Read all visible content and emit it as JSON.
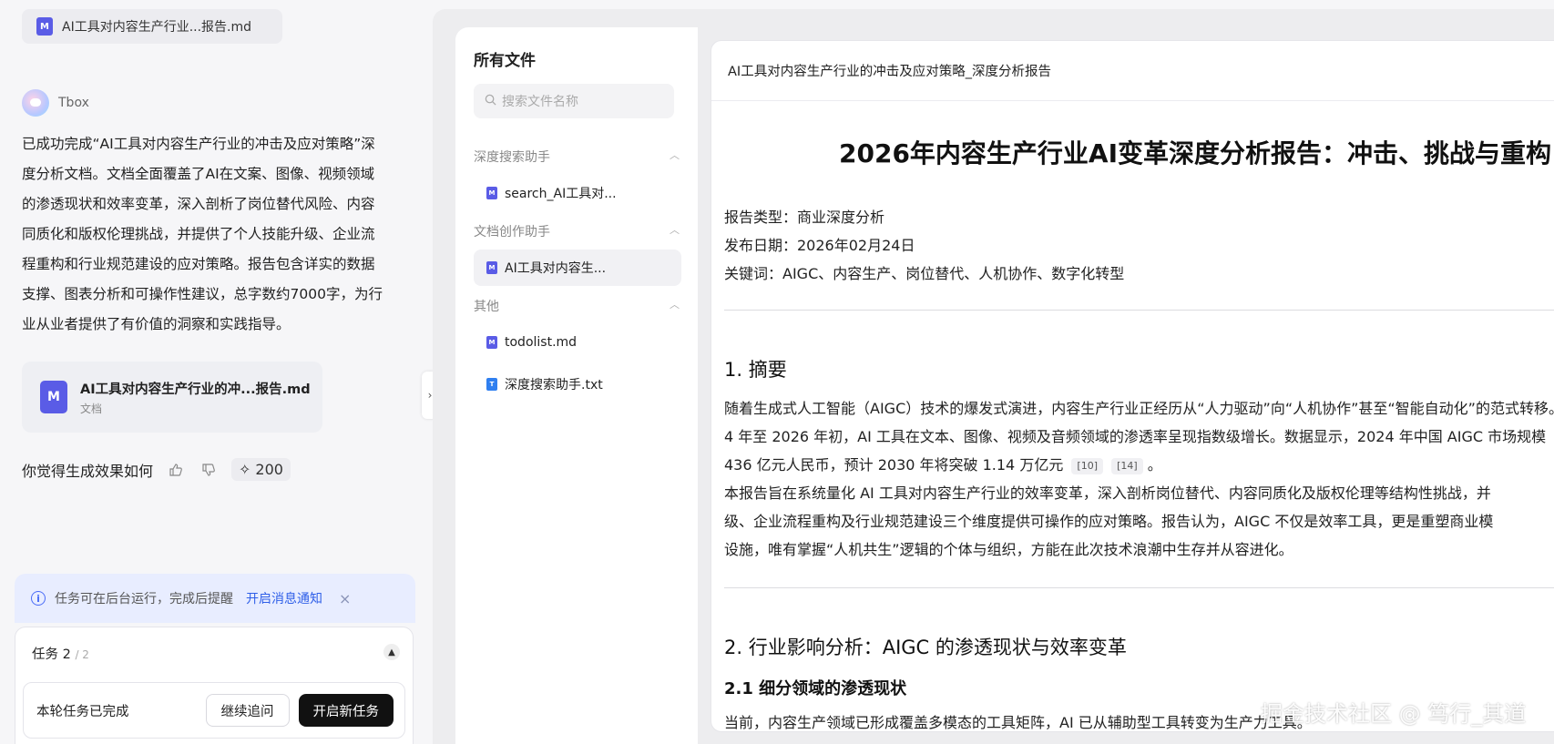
{
  "chat": {
    "top_file_chip": "AI工具对内容生产行业...报告.md",
    "bot_name": "Tbox",
    "answer_lines": [
      "已成功完成“AI工具对内容生产行业的冲击及应对策略”深",
      "度分析文档。文档全面覆盖了AI在文案、图像、视频领域",
      "的渗透现状和效率变革，深入剖析了岗位替代风险、内容",
      "同质化和版权伦理挑战，并提供了个人技能升级、企业流",
      "程重构和行业规范建设的应对策略。报告包含详实的数据",
      "支撑、图表分析和可操作性建议，总字数约7000字，为行",
      "业从业者提供了有价值的洞察和实践指导。"
    ],
    "doc_card": {
      "title": "AI工具对内容生产行业的冲...报告.md",
      "subtitle": "文档",
      "icon_letter": "M"
    },
    "feedback": {
      "question": "你觉得生成效果如何",
      "points": "200"
    },
    "notice": {
      "text": "任务可在后台运行，完成后提醒",
      "link": "开启消息通知",
      "close": "×"
    },
    "tasks": {
      "label": "任务 2",
      "fraction": "/ 2",
      "status": "本轮任务已完成",
      "continue_btn": "继续追问",
      "new_btn": "开启新任务"
    }
  },
  "files": {
    "title": "所有文件",
    "search_placeholder": "搜索文件名称",
    "groups": [
      {
        "name": "深度搜索助手",
        "items": [
          "search_AI工具对..."
        ]
      },
      {
        "name": "文档创作助手",
        "items": [
          "AI工具对内容生..."
        ]
      },
      {
        "name": "其他",
        "items": [
          "todolist.md",
          "深度搜索助手.txt"
        ]
      }
    ]
  },
  "document": {
    "bar_title": "AI工具对内容生产行业的冲击及应对策略_深度分析报告",
    "h1": "2026年内容生产行业AI变革深度分析报告：冲击、挑战与重构",
    "meta": [
      "报告类型：商业深度分析",
      "发布日期：2026年02月24日",
      "关键词：AIGC、内容生产、岗位替代、人机协作、数字化转型"
    ],
    "section1": {
      "heading": "1. 摘要",
      "lines": [
        "随着生成式人工智能（AIGC）技术的爆发式演进，内容生产行业正经历从“人力驱动”向“人机协作”甚至“智能自动化”的范式转移。",
        "4 年至 2026 年初，AI 工具在文本、图像、视频及音频领域的渗透率呈现指数级增长。数据显示，2024 年中国 AIGC 市场规模",
        "436 亿元人民币，预计 2030 年将突破 1.14 万亿元",
        "本报告旨在系统量化 AI 工具对内容生产行业的效率变革，深入剖析岗位替代、内容同质化及版权伦理等结构性挑战，并",
        "级、企业流程重构及行业规范建设三个维度提供可操作的应对策略。报告认为，AIGC 不仅是效率工具，更是重塑商业模",
        "设施，唯有掌握“人机共生”逻辑的个体与组织，方能在此次技术浪潮中生存并从容进化。"
      ],
      "cite1": "[10]",
      "cite2": "[14]",
      "period": "。"
    },
    "section2": {
      "heading": "2. 行业影响分析：AIGC 的渗透现状与效率变革",
      "sub": "2.1 细分领域的渗透现状",
      "partial": "当前，内容生产领域已形成覆盖多模态的工具矩阵，AI 已从辅助型工具转变为生产力工具。"
    }
  },
  "watermark": "掘金技术社区 @ 笃行_其道"
}
